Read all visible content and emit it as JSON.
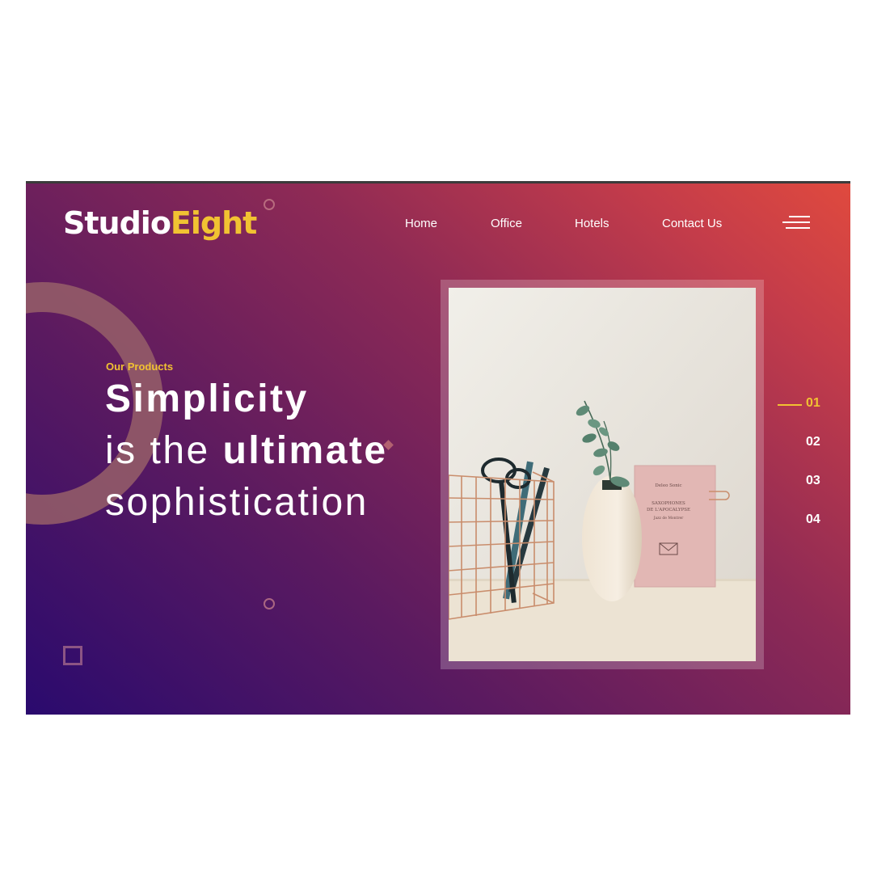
{
  "brand": {
    "part1": "Studio",
    "part2": "Eight",
    "accent_color": "#f1c232"
  },
  "nav": {
    "items": [
      {
        "label": "Home"
      },
      {
        "label": "Office"
      },
      {
        "label": "Hotels"
      },
      {
        "label": "Contact Us"
      }
    ],
    "menu_icon": "hamburger-icon"
  },
  "hero": {
    "eyebrow": "Our Products",
    "line1": "Simplicity",
    "line2_prefix": "is the ",
    "line2_strong": "ultimate",
    "line3": "sophistication"
  },
  "pager": {
    "items": [
      {
        "label": "01",
        "active": true
      },
      {
        "label": "02",
        "active": false
      },
      {
        "label": "03",
        "active": false
      },
      {
        "label": "04",
        "active": false
      }
    ]
  },
  "photo": {
    "book_lines": [
      "Deleo Sonic",
      "SAXOPHONES",
      "DE L'APOCALYPSE",
      "Jazz de Montrer"
    ]
  },
  "colors": {
    "gradient_start": "#2a0a6e",
    "gradient_end": "#e04a3e",
    "accent": "#f1c232"
  }
}
